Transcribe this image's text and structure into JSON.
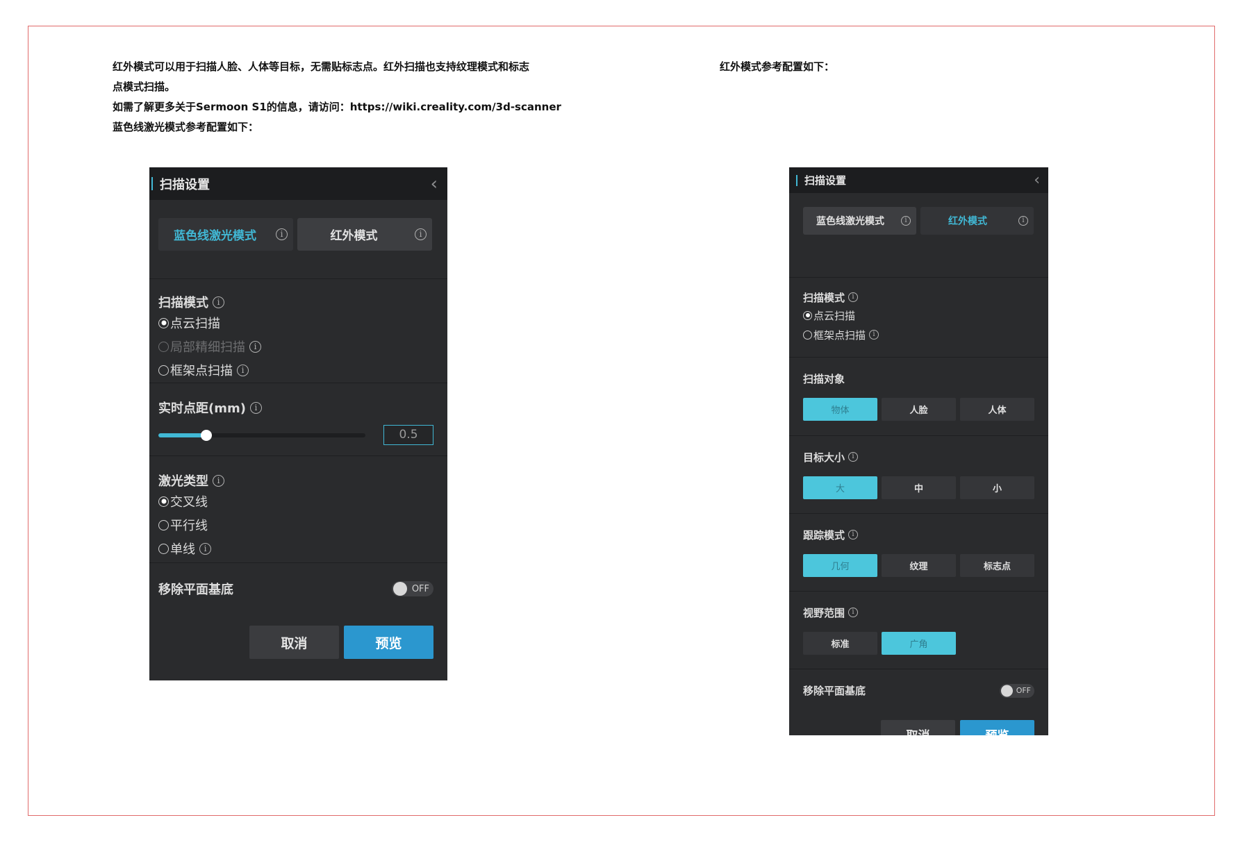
{
  "intro_left": {
    "line1": "红外模式可以用于扫描人脸、人体等目标，无需贴标志点。红外扫描也支持纹理模式和标志",
    "line2": "点模式扫描。",
    "line3": "如需了解更多关于Sermoon S1的信息，请访问：https://wiki.creality.com/3d-scanner",
    "line4": "蓝色线激光模式参考配置如下："
  },
  "intro_right": {
    "line1": "红外模式参考配置如下："
  },
  "panel_blue": {
    "title": "扫描设置",
    "back_icon": "‹",
    "modes": [
      {
        "label": "蓝色线激光模式",
        "selected": true
      },
      {
        "label": "红外模式",
        "selected": false
      }
    ],
    "scan_mode": {
      "title": "扫描模式",
      "options": [
        {
          "label": "点云扫描",
          "checked": true,
          "disabled": false,
          "info": false
        },
        {
          "label": "局部精细扫描",
          "checked": false,
          "disabled": true,
          "info": true
        },
        {
          "label": "框架点扫描",
          "checked": false,
          "disabled": false,
          "info": true
        }
      ]
    },
    "point_distance": {
      "title": "实时点距(mm)",
      "value": "0.5",
      "slider_fraction": 0.23
    },
    "laser_type": {
      "title": "激光类型",
      "options": [
        {
          "label": "交叉线",
          "checked": true,
          "info": false
        },
        {
          "label": "平行线",
          "checked": false,
          "info": false
        },
        {
          "label": "单线",
          "checked": false,
          "info": true
        }
      ]
    },
    "remove_base": {
      "label": "移除平面基底",
      "state": "OFF"
    },
    "buttons": {
      "cancel": "取消",
      "preview": "预览"
    }
  },
  "panel_ir": {
    "title": "扫描设置",
    "back_icon": "‹",
    "modes": [
      {
        "label": "蓝色线激光模式",
        "selected": false
      },
      {
        "label": "红外模式",
        "selected": true
      }
    ],
    "scan_mode": {
      "title": "扫描模式",
      "options": [
        {
          "label": "点云扫描",
          "checked": true,
          "info": false
        },
        {
          "label": "框架点扫描",
          "checked": false,
          "info": true
        }
      ]
    },
    "scan_target": {
      "title": "扫描对象",
      "options": [
        "物体",
        "人脸",
        "人体"
      ],
      "selected": 0
    },
    "target_size": {
      "title": "目标大小",
      "options": [
        "大",
        "中",
        "小"
      ],
      "selected": 0
    },
    "tracking_mode": {
      "title": "跟踪模式",
      "options": [
        "几何",
        "纹理",
        "标志点"
      ],
      "selected": 0
    },
    "field_of_view": {
      "title": "视野范围",
      "options": [
        "标准",
        "广角"
      ],
      "selected": 1
    },
    "remove_base": {
      "label": "移除平面基底",
      "state": "OFF"
    },
    "buttons": {
      "cancel": "取消",
      "preview": "预览"
    }
  },
  "colors": {
    "accent": "#41b8d5",
    "panel_bg": "#2a2b2d",
    "preview_btn": "#2b97cf",
    "frame_border": "#e06a6a"
  }
}
